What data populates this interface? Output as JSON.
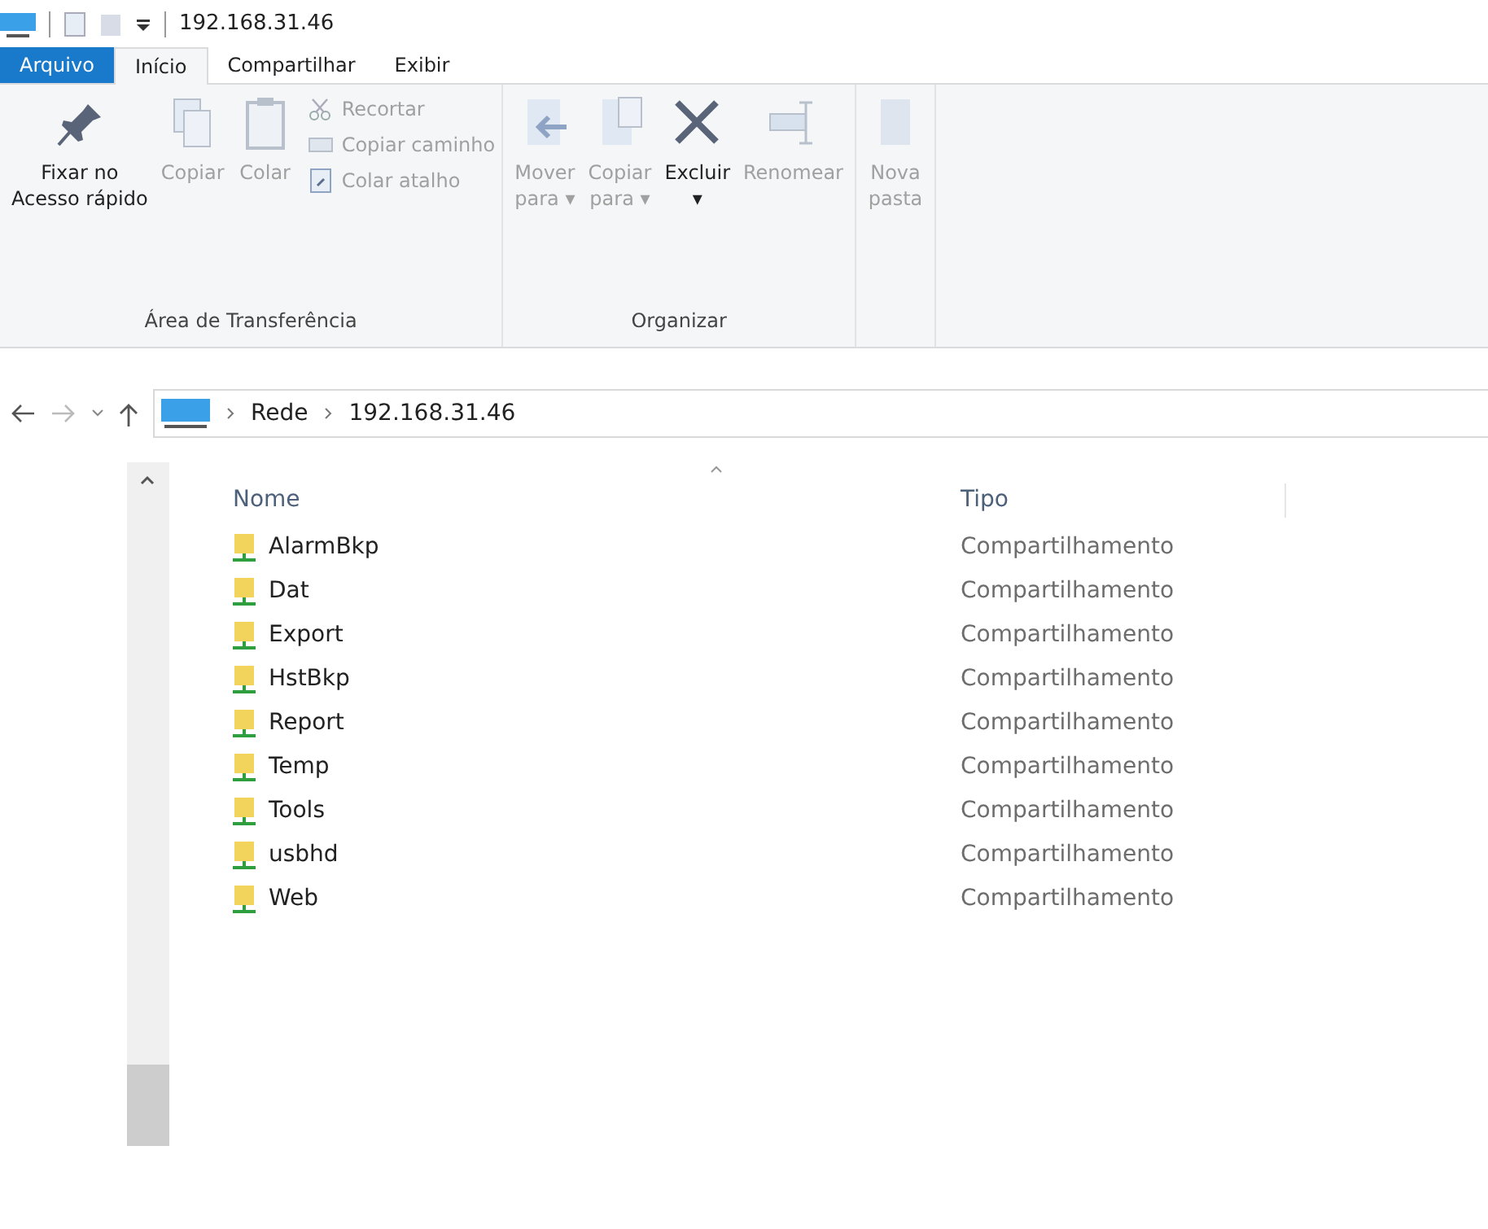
{
  "window": {
    "title": "192.168.31.46"
  },
  "tabs": [
    {
      "label": "Arquivo",
      "kind": "file",
      "selected": false
    },
    {
      "label": "Início",
      "kind": "tab",
      "selected": true
    },
    {
      "label": "Compartilhar",
      "kind": "tab",
      "selected": false
    },
    {
      "label": "Exibir",
      "kind": "tab",
      "selected": false
    }
  ],
  "ribbon_groups": [
    {
      "label": "Área de Transferência",
      "items": [
        {
          "kind": "pin",
          "lines": [
            "Fixar no",
            "Acesso rápido"
          ],
          "disabled": false
        },
        {
          "kind": "copy",
          "lines": [
            "Copiar"
          ],
          "disabled": true
        },
        {
          "kind": "paste",
          "lines": [
            "Colar"
          ],
          "disabled": true
        },
        {
          "kind": "stack",
          "items": [
            {
              "kind": "cut",
              "label": "Recortar",
              "disabled": true
            },
            {
              "kind": "path",
              "label": "Copiar caminho",
              "disabled": true
            },
            {
              "kind": "shortcut",
              "label": "Colar atalho",
              "disabled": true
            }
          ]
        }
      ]
    },
    {
      "label": "Organizar",
      "items": [
        {
          "kind": "move",
          "lines": [
            "Mover",
            "para ▾"
          ],
          "disabled": true
        },
        {
          "kind": "copyto",
          "lines": [
            "Copiar",
            "para ▾"
          ],
          "disabled": true
        },
        {
          "kind": "delete",
          "lines": [
            "Excluir",
            "▾"
          ],
          "disabled": false
        },
        {
          "kind": "rename",
          "lines": [
            "Renomear"
          ],
          "disabled": true
        }
      ]
    },
    {
      "items": [
        {
          "kind": "folder",
          "lines": [
            "Nova",
            "pasta"
          ],
          "disabled": true
        }
      ]
    }
  ],
  "address": {
    "segments": [
      "Rede",
      "192.168.31.46"
    ]
  },
  "columns": [
    "Nome",
    "Tipo"
  ],
  "rows": [
    {
      "name": "AlarmBkp",
      "type": "Compartilhamento"
    },
    {
      "name": "Dat",
      "type": "Compartilhamento"
    },
    {
      "name": "Export",
      "type": "Compartilhamento"
    },
    {
      "name": "HstBkp",
      "type": "Compartilhamento"
    },
    {
      "name": "Report",
      "type": "Compartilhamento"
    },
    {
      "name": "Temp",
      "type": "Compartilhamento"
    },
    {
      "name": "Tools",
      "type": "Compartilhamento"
    },
    {
      "name": "usbhd",
      "type": "Compartilhamento"
    },
    {
      "name": "Web",
      "type": "Compartilhamento"
    }
  ]
}
